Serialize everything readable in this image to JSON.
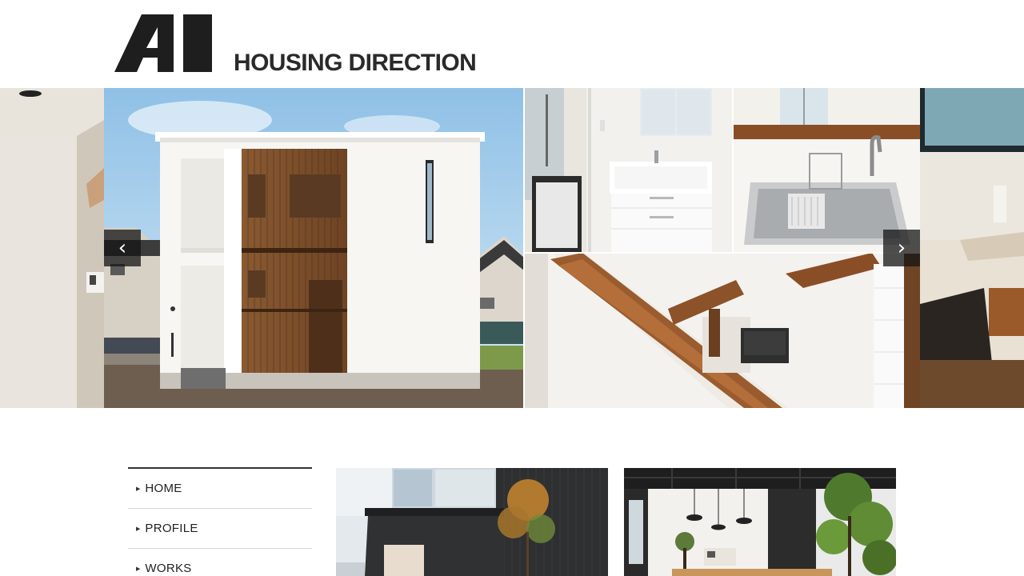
{
  "logo": {
    "mark_text": "AI",
    "text": "HOUSING DIRECTION"
  },
  "slider": {
    "prev_arrow": "‹",
    "next_arrow": "›",
    "slides": [
      {
        "name": "interior-room-prev"
      },
      {
        "name": "white-house-exterior"
      },
      {
        "name": "bathroom-vanity"
      },
      {
        "name": "kitchen-sink"
      },
      {
        "name": "stairwell-wood-handrail"
      },
      {
        "name": "interior-desk-next"
      }
    ]
  },
  "nav": {
    "items": [
      {
        "label": "HOME"
      },
      {
        "label": "PROFILE"
      },
      {
        "label": "WORKS"
      }
    ]
  },
  "thumbnails": [
    {
      "name": "dark-house-exterior"
    },
    {
      "name": "office-interior"
    }
  ],
  "colors": {
    "arrow_bg": "#141414",
    "nav_border_top": "#333333",
    "nav_divider": "#d6d6d6",
    "logo_text": "#2a2a2a"
  }
}
